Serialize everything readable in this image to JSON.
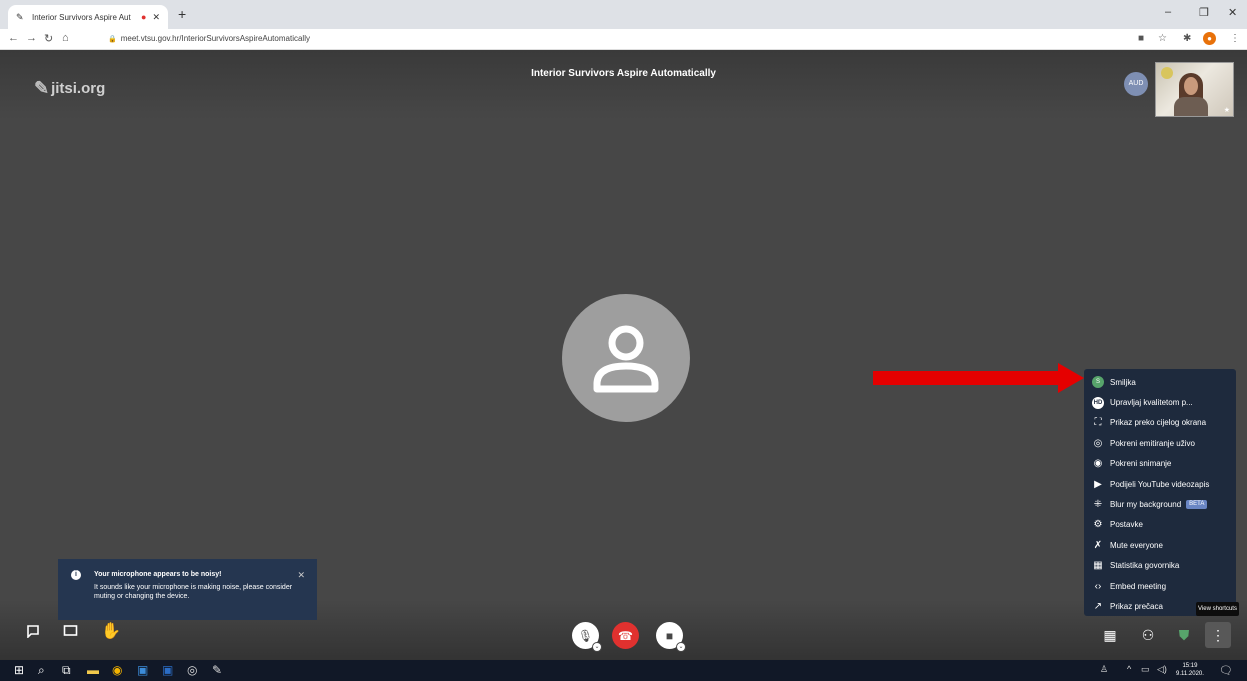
{
  "browser": {
    "tab_title": "Interior Survivors Aspire Aut",
    "url": "meet.vtsu.gov.hr/InteriorSurvivorsAspireAutomatically",
    "new_tab": "+",
    "minimize": "–",
    "maximize": "❐",
    "close": "✕"
  },
  "meeting": {
    "logo": "jitsi.org",
    "title": "Interior Survivors Aspire Automatically",
    "self_avatar_initials": "AUD"
  },
  "menu": {
    "items": [
      {
        "label": "Smiljka",
        "icon": "avatar-icon"
      },
      {
        "label": "Upravljaj kvalitetom p...",
        "icon": "hd-icon"
      },
      {
        "label": "Prikaz preko cijelog okrana",
        "icon": "fullscreen-icon"
      },
      {
        "label": "Pokreni emitiranje uživo",
        "icon": "livestream-icon"
      },
      {
        "label": "Pokreni snimanje",
        "icon": "record-icon"
      },
      {
        "label": "Podijeli YouTube videozapis",
        "icon": "youtube-icon"
      },
      {
        "label": "Blur my background",
        "icon": "blur-icon",
        "badge": "BETA"
      },
      {
        "label": "Postavke",
        "icon": "gear-icon"
      },
      {
        "label": "Mute everyone",
        "icon": "mute-everyone-icon"
      },
      {
        "label": "Statistika govornika",
        "icon": "stats-icon"
      },
      {
        "label": "Embed meeting",
        "icon": "embed-icon"
      },
      {
        "label": "Prikaz prečaca",
        "icon": "shortcuts-icon"
      }
    ],
    "tooltip": "View shortcuts"
  },
  "notification": {
    "title": "Your microphone appears to be noisy!",
    "body": "It sounds like your microphone is making noise, please consider muting or changing the device."
  },
  "taskbar": {
    "time": "15:19",
    "date": "9.11.2020."
  },
  "colors": {
    "stage": "#474747",
    "menu_bg": "#1e2a3d",
    "notification_bg": "#253650",
    "hangup": "#e0312f",
    "arrow": "#e50000",
    "accent_green": "#57a46b"
  }
}
